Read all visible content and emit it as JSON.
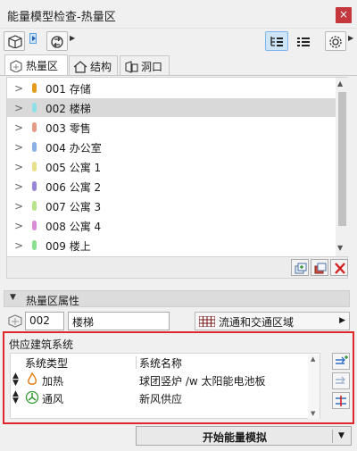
{
  "window": {
    "title": "能量模型检查-热量区",
    "close_symbol": "×"
  },
  "tabs": [
    {
      "label": "热量区",
      "icon": "thermal-block-icon"
    },
    {
      "label": "结构",
      "icon": "house-icon"
    },
    {
      "label": "洞口",
      "icon": "opening-icon"
    }
  ],
  "zones": [
    {
      "label": "001 存储",
      "color": "#e49a1a",
      "selected": false
    },
    {
      "label": "002 楼梯",
      "color": "#8fe0e6",
      "selected": true
    },
    {
      "label": "003 零售",
      "color": "#e49a84",
      "selected": false
    },
    {
      "label": "004 办公室",
      "color": "#8ab1e4",
      "selected": false
    },
    {
      "label": "005 公寓 1",
      "color": "#e6e08a",
      "selected": false
    },
    {
      "label": "006 公寓 2",
      "color": "#9a86d9",
      "selected": false
    },
    {
      "label": "007 公寓 3",
      "color": "#b7e48a",
      "selected": false
    },
    {
      "label": "008 公寓 4",
      "color": "#d78ad6",
      "selected": false
    },
    {
      "label": "009  楼上",
      "color": "#8ae08f",
      "selected": false
    }
  ],
  "properties": {
    "section_label": "热量区属性",
    "number": "002",
    "name": "楼梯",
    "category": "流通和交通区域"
  },
  "systems": {
    "header": "供应建筑系统",
    "col_type": "系统类型",
    "col_name": "系统名称",
    "rows": [
      {
        "type": "加热",
        "name": "球团竖炉 /w 太阳能电池板",
        "icon": "flame-icon"
      },
      {
        "type": "通风",
        "name": "新风供应",
        "icon": "fan-icon"
      }
    ]
  },
  "start_button": "开始能量模拟",
  "colors": {
    "close": "#c4383d",
    "highlight_border": "#e0262c",
    "selected_row": "#d9d9d9",
    "toggle_active": "#cde5f7"
  }
}
